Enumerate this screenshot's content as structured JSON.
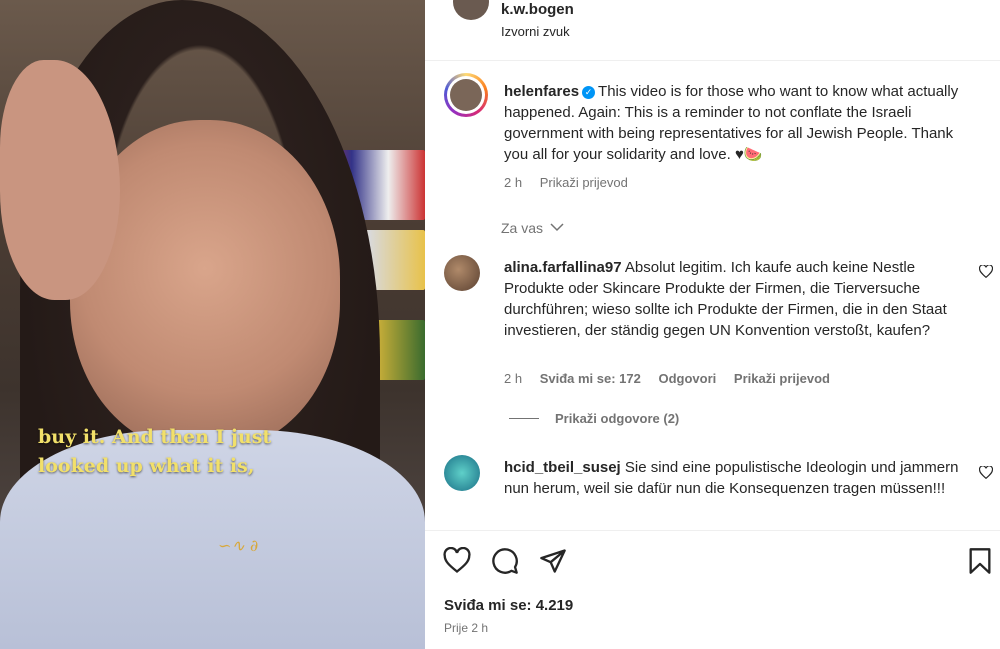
{
  "post": {
    "caption_overlay": [
      "buy it. And then I just",
      "looked up what it is,"
    ]
  },
  "header": {
    "username": "k.w.bogen",
    "audio": "Izvorni zvuk"
  },
  "caption": {
    "username": "helenfares",
    "text": "This video is for those who want to know what actually happened. Again: This is a reminder to not conflate the Israeli government with being representatives for all Jewish People. Thank you all for your solidarity and love. ♥🍉",
    "time": "2 h",
    "translate": "Prikaži prijevod"
  },
  "filter_label": "Za vas",
  "comments": [
    {
      "username": "alina.farfallina97",
      "text": "Absolut legitim. Ich kaufe auch keine Nestle Produkte oder Skincare Produkte der Firmen, die Tierversuche durchführen; wieso sollte ich Produkte der Firmen, die in den Staat investieren, der ständig gegen UN Konvention verstoßt, kaufen?",
      "time": "2 h",
      "likes": "Sviđa mi se: 172",
      "reply": "Odgovori",
      "translate": "Prikaži prijevod",
      "view_replies": "Prikaži odgovore (2)"
    },
    {
      "username": "hcid_tbeil_susej",
      "text": "Sie sind eine populistische Ideologin und jammern nun herum, weil sie dafür nun die Konsequenzen tragen müssen!!!"
    }
  ],
  "footer": {
    "likes": "Sviđa mi se: 4.219",
    "ago": "Prije 2 h"
  },
  "colors": {
    "verified": "#0095f6",
    "secondary_text": "#737373",
    "caption_overlay": "#f2e06a"
  }
}
